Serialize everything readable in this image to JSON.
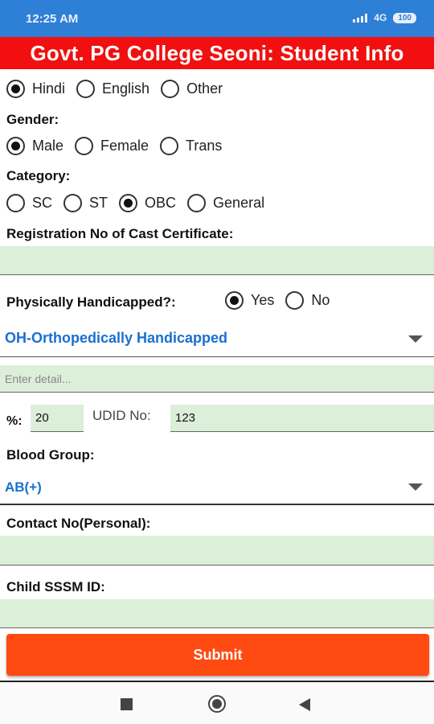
{
  "status_bar": {
    "time": "12:25 AM",
    "network": "4G",
    "battery": "100"
  },
  "app": {
    "title": "Govt. PG College Seoni: Student Info"
  },
  "language": {
    "options": [
      "Hindi",
      "English",
      "Other"
    ],
    "selected": "Hindi"
  },
  "gender": {
    "label": "Gender:",
    "options": [
      "Male",
      "Female",
      "Trans"
    ],
    "selected": "Male"
  },
  "category": {
    "label": "Category:",
    "options": [
      "SC",
      "ST",
      "OBC",
      "General"
    ],
    "selected": "OBC"
  },
  "registration": {
    "label": "Registration No of Cast Certificate:",
    "value": ""
  },
  "handicapped": {
    "label": "Physically Handicapped?:",
    "options": [
      "Yes",
      "No"
    ],
    "selected": "Yes",
    "type_selected": "OH-Orthopedically Handicapped",
    "detail_placeholder": "Enter detail...",
    "percent_label": "%:",
    "percent_value": "20",
    "udid_label": "UDID No:",
    "udid_value": "123"
  },
  "blood_group": {
    "label": "Blood Group:",
    "selected": "AB(+)"
  },
  "contact": {
    "label": "Contact No(Personal):",
    "value": ""
  },
  "child_sssm": {
    "label": "Child SSSM ID:",
    "value": ""
  },
  "submit": {
    "label": "Submit"
  },
  "colors": {
    "title_bg": "#f20f0f",
    "status_bg": "#2e7fd6",
    "field_bg": "#dcefd9",
    "spinner_text": "#1a6fd0",
    "submit_bg": "#ff4a12"
  }
}
